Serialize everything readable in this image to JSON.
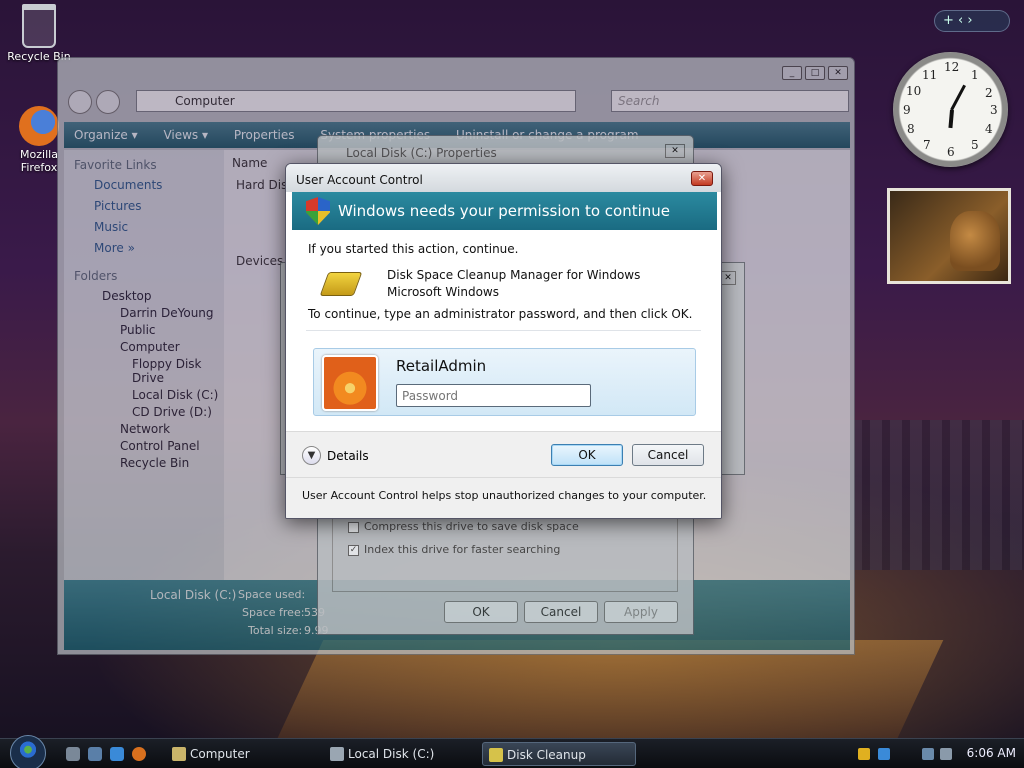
{
  "desktop": {
    "recycle_bin_label": "Recycle Bin",
    "firefox_label": "Mozilla Firefox"
  },
  "clock": {
    "numbers": [
      "12",
      "1",
      "2",
      "3",
      "4",
      "5",
      "6",
      "7",
      "8",
      "9",
      "10",
      "11"
    ]
  },
  "explorer": {
    "address": "Computer",
    "search_placeholder": "Search",
    "toolbar": [
      "Organize ▾",
      "Views ▾",
      "Properties",
      "System properties",
      "Uninstall or change a program"
    ],
    "favorite_links_header": "Favorite Links",
    "favorite_links": [
      "Documents",
      "Pictures",
      "Music",
      "More »"
    ],
    "folders_header": "Folders",
    "tree": [
      {
        "label": "Desktop",
        "level": 1
      },
      {
        "label": "Darrin DeYoung",
        "level": 2
      },
      {
        "label": "Public",
        "level": 2
      },
      {
        "label": "Computer",
        "level": 2
      },
      {
        "label": "Floppy Disk Drive",
        "level": 3
      },
      {
        "label": "Local Disk (C:)",
        "level": 3
      },
      {
        "label": "CD Drive (D:)",
        "level": 3
      },
      {
        "label": "Network",
        "level": 2
      },
      {
        "label": "Control Panel",
        "level": 2
      },
      {
        "label": "Recycle Bin",
        "level": 2
      }
    ],
    "column_name": "Name",
    "group_hard_disk": "Hard Disk",
    "group_devices": "Devices",
    "details": {
      "drive_name": "Local Disk (C:)",
      "space_used_label": "Space used:",
      "space_free_label": "Space free:",
      "space_free_value": "539",
      "total_size_label": "Total size:",
      "total_size_value": "9.99"
    }
  },
  "properties_dialog": {
    "title": "Local Disk (C:) Properties",
    "compress_label": "Compress this drive to save disk space",
    "compress_checked": false,
    "index_label": "Index this drive for faster searching",
    "index_checked": true,
    "ok": "OK",
    "cancel": "Cancel",
    "apply": "Apply"
  },
  "uac": {
    "title": "User Account Control",
    "banner": "Windows needs your permission to continue",
    "intro": "If you started this action, continue.",
    "program_name": "Disk Space Cleanup Manager for Windows",
    "publisher": "Microsoft Windows",
    "instruction": "To continue, type an administrator password, and then click OK.",
    "username": "RetailAdmin",
    "password_placeholder": "Password",
    "details": "Details",
    "ok": "OK",
    "cancel": "Cancel",
    "footer": "User Account Control helps stop unauthorized changes to your computer."
  },
  "taskbar": {
    "tasks": [
      "Computer",
      "Local Disk (C:) Prop...",
      "Disk Cleanup Options"
    ],
    "active_task_index": 2,
    "time": "6:06 AM"
  }
}
